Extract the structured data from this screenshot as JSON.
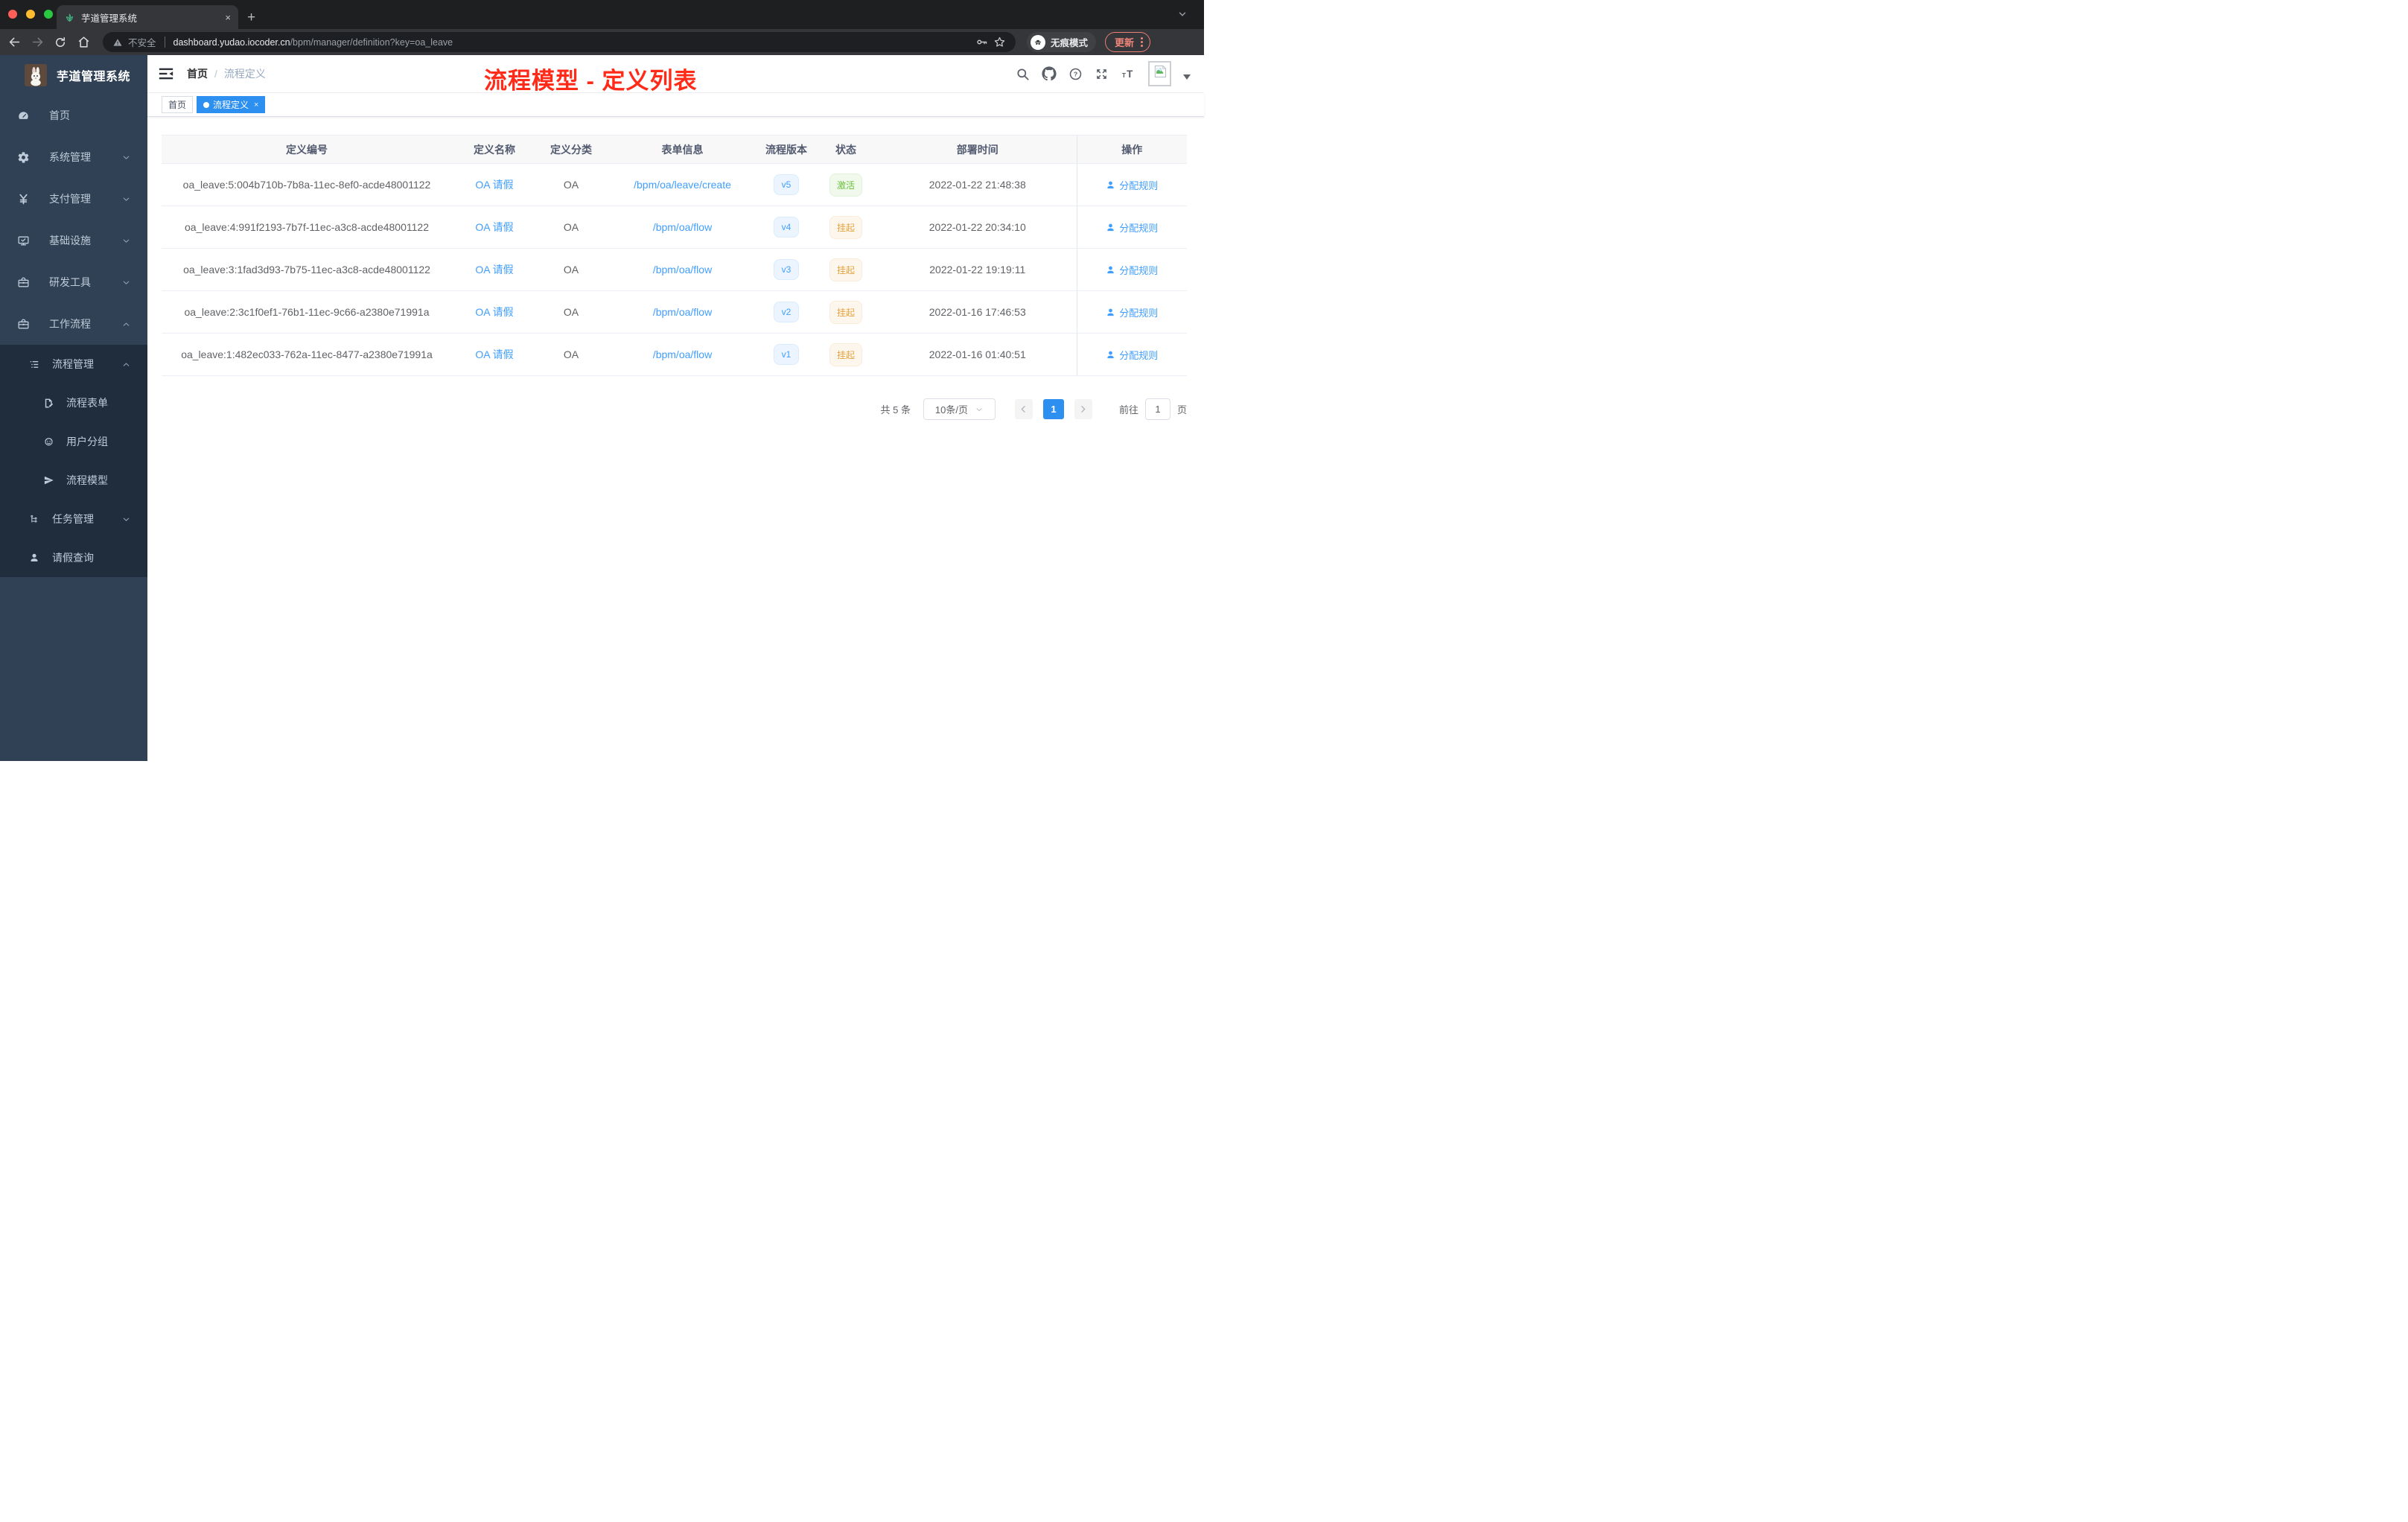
{
  "browser": {
    "tab": {
      "title": "芋道管理系统",
      "close": "×",
      "new_tab": "+"
    },
    "toolbar": {
      "security_label": "不安全",
      "url_domain": "dashboard.yudao.iocoder.cn",
      "url_path": "/bpm/manager/definition?key=oa_leave",
      "incognito_label": "无痕模式",
      "update_label": "更新"
    }
  },
  "sidebar": {
    "logo_title": "芋道管理系统",
    "menu": [
      {
        "label": "首页",
        "icon": "dashboard-icon"
      },
      {
        "label": "系统管理",
        "icon": "gear-icon",
        "expand": "down"
      },
      {
        "label": "支付管理",
        "icon": "yen-icon",
        "expand": "down"
      },
      {
        "label": "基础设施",
        "icon": "monitor-icon",
        "expand": "down"
      },
      {
        "label": "研发工具",
        "icon": "toolbox-icon",
        "expand": "down"
      },
      {
        "label": "工作流程",
        "icon": "workflow-icon",
        "expand": "up"
      }
    ],
    "submenu": [
      {
        "label": "流程管理",
        "icon": "list-tree-icon",
        "expand": "up"
      },
      {
        "label": "流程表单",
        "icon": "form-edit-icon"
      },
      {
        "label": "用户分组",
        "icon": "user-group-icon"
      },
      {
        "label": "流程模型",
        "icon": "paper-plane-icon"
      },
      {
        "label": "任务管理",
        "icon": "task-tree-icon",
        "expand": "down"
      },
      {
        "label": "请假查询",
        "icon": "person-icon"
      }
    ]
  },
  "header": {
    "breadcrumb": {
      "home": "首页",
      "separator": "/",
      "current": "流程定义"
    },
    "annotation": "流程模型 - 定义列表"
  },
  "tags": {
    "inactive": "首页",
    "active": "流程定义",
    "close": "×"
  },
  "table": {
    "columns": [
      "定义编号",
      "定义名称",
      "定义分类",
      "表单信息",
      "流程版本",
      "状态",
      "部署时间",
      "操作"
    ],
    "action_label": "分配规则",
    "rows": [
      {
        "id": "oa_leave:5:004b710b-7b8a-11ec-8ef0-acde48001122",
        "name": "OA 请假",
        "category": "OA",
        "form": "/bpm/oa/leave/create",
        "version": "v5",
        "status": "激活",
        "status_type": "success",
        "time": "2022-01-22 21:48:38"
      },
      {
        "id": "oa_leave:4:991f2193-7b7f-11ec-a3c8-acde48001122",
        "name": "OA 请假",
        "category": "OA",
        "form": "/bpm/oa/flow",
        "version": "v4",
        "status": "挂起",
        "status_type": "warning",
        "time": "2022-01-22 20:34:10"
      },
      {
        "id": "oa_leave:3:1fad3d93-7b75-11ec-a3c8-acde48001122",
        "name": "OA 请假",
        "category": "OA",
        "form": "/bpm/oa/flow",
        "version": "v3",
        "status": "挂起",
        "status_type": "warning",
        "time": "2022-01-22 19:19:11"
      },
      {
        "id": "oa_leave:2:3c1f0ef1-76b1-11ec-9c66-a2380e71991a",
        "name": "OA 请假",
        "category": "OA",
        "form": "/bpm/oa/flow",
        "version": "v2",
        "status": "挂起",
        "status_type": "warning",
        "time": "2022-01-16 17:46:53"
      },
      {
        "id": "oa_leave:1:482ec033-762a-11ec-8477-a2380e71991a",
        "name": "OA 请假",
        "category": "OA",
        "form": "/bpm/oa/flow",
        "version": "v1",
        "status": "挂起",
        "status_type": "warning",
        "time": "2022-01-16 01:40:51"
      }
    ]
  },
  "pagination": {
    "total": "共 5 条",
    "page_size": "10条/页",
    "page": "1",
    "goto_label": "前往",
    "goto_value": "1",
    "page_unit": "页"
  },
  "colors": {
    "accent": "#409eff",
    "active_tag": "#2d8ff0",
    "success": "#67c23a",
    "warning": "#e6a23c",
    "annotation_red": "#fe2b18",
    "sidebar_bg": "#304156",
    "submenu_bg": "#1f2d3d"
  }
}
